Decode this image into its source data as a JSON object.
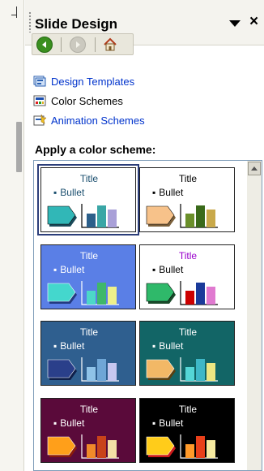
{
  "pane": {
    "title": "Slide Design",
    "close_glyph": "×"
  },
  "nav": {
    "back_icon": "back-arrow-icon",
    "forward_icon": "forward-arrow-icon",
    "home_icon": "home-icon"
  },
  "links": [
    {
      "label": "Design Templates",
      "icon": "design-templates-icon"
    },
    {
      "label": "Color Schemes",
      "icon": "color-schemes-icon"
    },
    {
      "label": "Animation Schemes",
      "icon": "animation-schemes-icon"
    }
  ],
  "section_label": "Apply a color scheme:",
  "schemes": [
    {
      "title": "Title",
      "bullet": "Bullet",
      "bg": "#ffffff",
      "title_color": "#1a4e6e",
      "text_color": "#1a4e6e",
      "arrow": "#31b7b7",
      "shadow": "#1b4a5a",
      "bars": [
        "#2c5f8a",
        "#3aa6a6",
        "#a9a0d8"
      ],
      "axis": "#000000",
      "selected": true
    },
    {
      "title": "Title",
      "bullet": "Bullet",
      "bg": "#ffffff",
      "title_color": "#000000",
      "text_color": "#000000",
      "arrow": "#f7c28a",
      "shadow": "#7a5f3a",
      "bars": [
        "#6a8f2a",
        "#3a6a1a",
        "#c9a94a"
      ],
      "axis": "#000000",
      "selected": false
    },
    {
      "title": "Title",
      "bullet": "Bullet",
      "bg": "#5a7fe6",
      "title_color": "#ffffff",
      "text_color": "#ffffff",
      "arrow": "#44d7cd",
      "shadow": "#233a80",
      "bars": [
        "#4cd8c8",
        "#3fb86a",
        "#eef08a"
      ],
      "axis": "#ffffff",
      "selected": false
    },
    {
      "title": "Title",
      "bullet": "Bullet",
      "bg": "#ffffff",
      "title_color": "#9900cc",
      "text_color": "#000000",
      "arrow": "#2fb96a",
      "shadow": "#1a4a2a",
      "bars": [
        "#cc0000",
        "#1a3a9a",
        "#e07ad0"
      ],
      "axis": "#000000",
      "selected": false
    },
    {
      "title": "Title",
      "bullet": "Bullet",
      "bg": "#2f5f8f",
      "title_color": "#ffffff",
      "text_color": "#ffffff",
      "arrow": "#2a3f8a",
      "shadow": "#0f1f4a",
      "bars": [
        "#8fc3e8",
        "#6fa6d6",
        "#c7c7f0"
      ],
      "axis": "#ffffff",
      "selected": false
    },
    {
      "title": "Title",
      "bullet": "Bullet",
      "bg": "#126566",
      "title_color": "#ffffff",
      "text_color": "#ffffff",
      "arrow": "#f2b866",
      "shadow": "#5a4010",
      "bars": [
        "#54d6d6",
        "#3eb7c7",
        "#ede682"
      ],
      "axis": "#ffffff",
      "selected": false
    },
    {
      "title": "Title",
      "bullet": "Bullet",
      "bg": "#5a0a3a",
      "title_color": "#ffffff",
      "text_color": "#ffffff",
      "arrow": "#ff9f1a",
      "shadow": "#8a1a0a",
      "bars": [
        "#f08a2a",
        "#c8431a",
        "#f3e0a6"
      ],
      "axis": "#ffffff",
      "selected": false
    },
    {
      "title": "Title",
      "bullet": "Bullet",
      "bg": "#000000",
      "title_color": "#ffffff",
      "text_color": "#ffffff",
      "arrow": "#ffcc1a",
      "shadow": "#cc1a1a",
      "bars": [
        "#ff9a2a",
        "#e8401a",
        "#f6eaa0"
      ],
      "axis": "#ffffff",
      "selected": false
    }
  ]
}
